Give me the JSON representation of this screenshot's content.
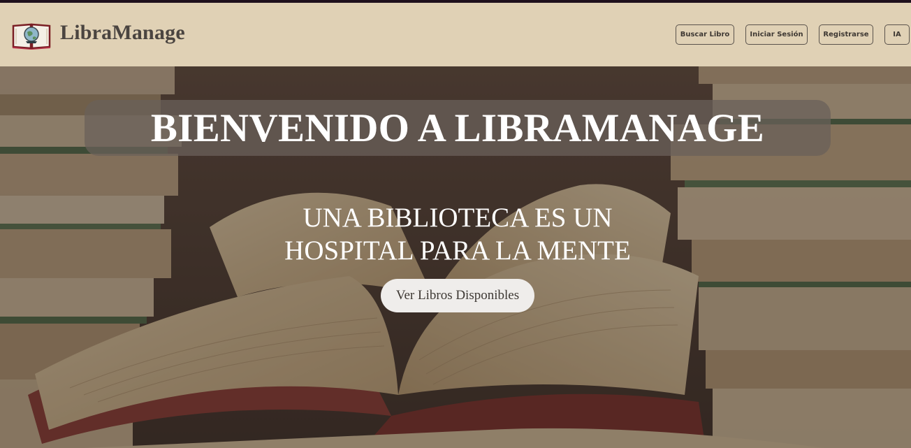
{
  "brand": {
    "name": "LibraManage",
    "logo_icon": "open-book-globe-icon"
  },
  "nav": {
    "items": [
      {
        "label": "Buscar Libro"
      },
      {
        "label": "Iniciar Sesión"
      },
      {
        "label": "Registrarse"
      },
      {
        "label": "IA"
      }
    ]
  },
  "hero": {
    "title": "BIENVENIDO A LIBRAMANAGE",
    "subtitle_line1": "UNA BIBLIOTECA ES UN",
    "subtitle_line2": "HOSPITAL PARA LA MENTE",
    "cta_label": "Ver Libros Disponibles",
    "background": "stacked-books-photo"
  },
  "colors": {
    "header_bg": "#e0d1b5",
    "top_strip": "#1e0f1c",
    "brand_text": "#4a4440",
    "title_box": "#69605a",
    "cta_bg": "#efedeb"
  }
}
